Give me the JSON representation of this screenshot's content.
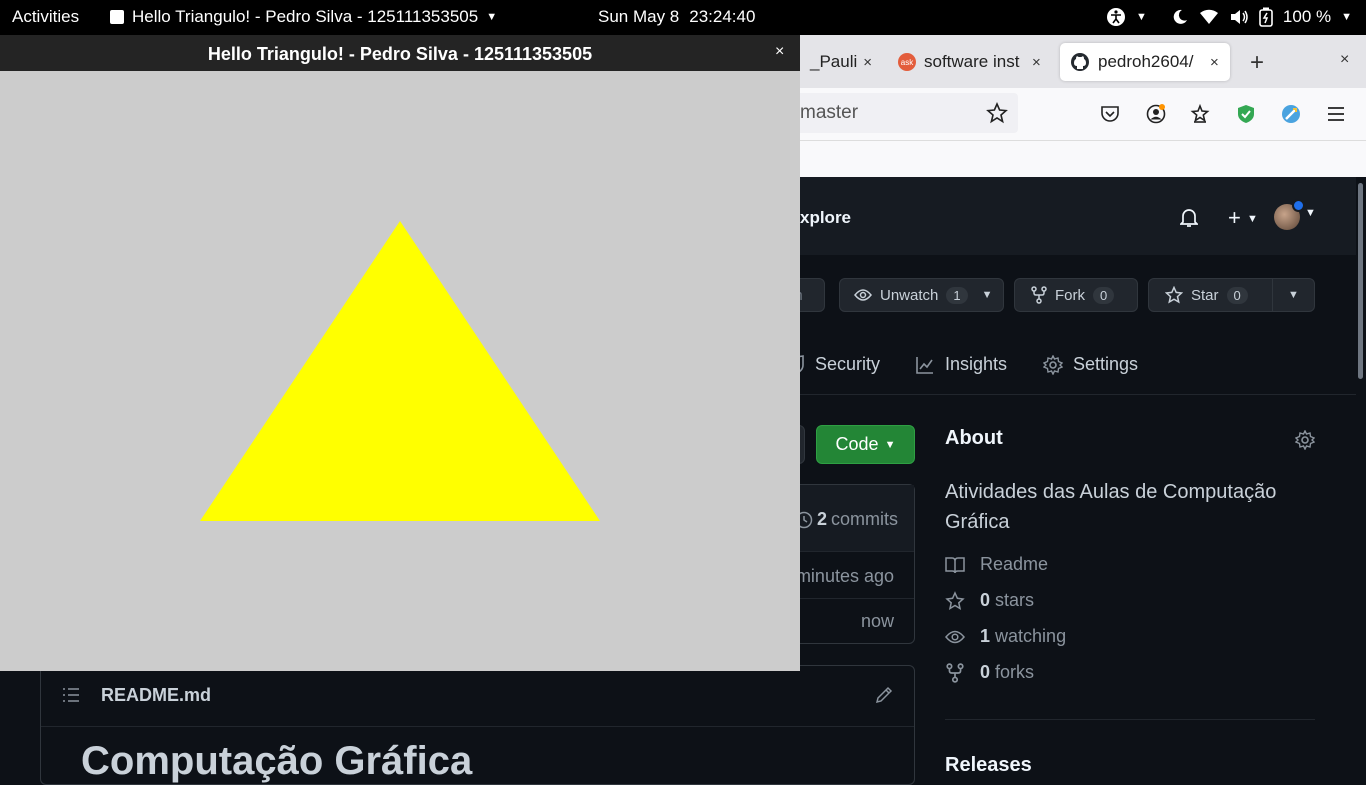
{
  "topbar": {
    "activities": "Activities",
    "app_title": "Hello Triangulo! - Pedro Silva - 125111353505",
    "date": "Sun May 8",
    "time": "23:24:40",
    "battery": "100 %"
  },
  "firefox": {
    "tabs": [
      {
        "label": "_Pauli",
        "close": "×"
      },
      {
        "label": "software inst",
        "favicon_text": "ask",
        "close": "×"
      },
      {
        "label": "pedroh2604/",
        "close": "×"
      }
    ],
    "new_tab": "+",
    "window_close": "×",
    "url_fragment": "master"
  },
  "github": {
    "explore": "xplore",
    "watch": {
      "label": "Unwatch",
      "count": "1"
    },
    "fork": {
      "label": "Fork",
      "count": "0"
    },
    "star": {
      "label": "Star",
      "count": "0"
    },
    "pin_fragment": "in",
    "repo_tabs": {
      "security": "Security",
      "insights": "Insights",
      "settings": "Settings"
    },
    "code_button": "Code",
    "commits": {
      "count": "2",
      "label": "commits",
      "row1": "minutes ago",
      "row2": "now"
    },
    "readme": {
      "file": "README.md",
      "heading": "Computação Gráfica"
    },
    "about": {
      "title": "About",
      "description": "Atividades das Aulas de Computação Gráfica",
      "readme": "Readme",
      "stars_count": "0",
      "stars_label": "stars",
      "watching_count": "1",
      "watching_label": "watching",
      "forks_count": "0",
      "forks_label": "forks",
      "releases": "Releases"
    }
  },
  "gl_window": {
    "title": "Hello Triangulo! - Pedro Silva - 125111353505",
    "close": "×",
    "background": "#cccccc",
    "triangle_color": "#ffff00"
  }
}
